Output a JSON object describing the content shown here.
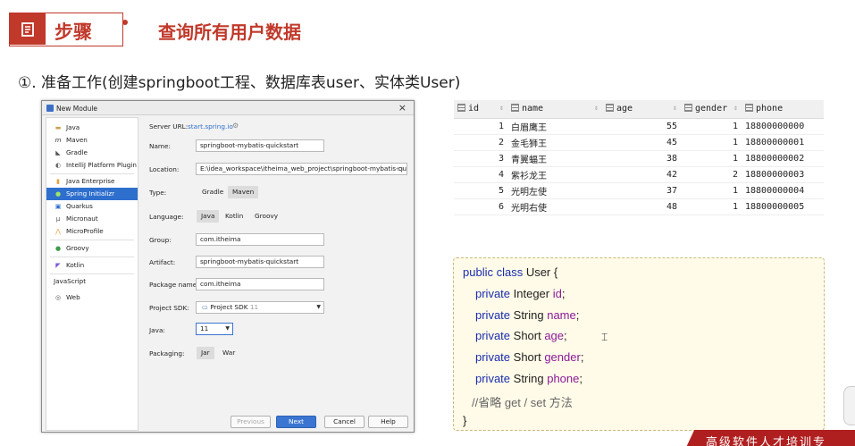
{
  "header": {
    "step_label": "步骤",
    "title": "查询所有用户数据"
  },
  "subheading": "①. 准备工作(创建springboot工程、数据库表user、实体类User)",
  "dialog": {
    "title": "New Module",
    "close": "×",
    "sidebar": [
      {
        "label": "Java",
        "icon": "folder-icon"
      },
      {
        "label": "Maven",
        "icon": "maven-icon"
      },
      {
        "label": "Gradle",
        "icon": "gradle-icon"
      },
      {
        "label": "IntelliJ Platform Plugin",
        "icon": "plugin-icon"
      },
      {
        "label": "Java Enterprise",
        "icon": "enterprise-icon"
      },
      {
        "label": "Spring Initializr",
        "icon": "spring-icon"
      },
      {
        "label": "Quarkus",
        "icon": "quarkus-icon"
      },
      {
        "label": "Micronaut",
        "icon": "micronaut-icon"
      },
      {
        "label": "MicroProfile",
        "icon": "microprofile-icon"
      },
      {
        "label": "Groovy",
        "icon": "groovy-icon"
      },
      {
        "label": "Kotlin",
        "icon": "kotlin-icon"
      },
      {
        "label": "JavaScript",
        "icon": ""
      },
      {
        "label": "Web",
        "icon": "web-icon"
      }
    ],
    "server_url_label": "Server URL:",
    "server_url": "start.spring.io",
    "name_label": "Name:",
    "name_value": "springboot-mybatis-quickstart",
    "location_label": "Location:",
    "location_value": "E:\\idea_workspace\\itheima_web_project\\springboot-mybatis-quic",
    "type_label": "Type:",
    "type_options": [
      "Gradle",
      "Maven"
    ],
    "language_label": "Language:",
    "language_options": [
      "Java",
      "Kotlin",
      "Groovy"
    ],
    "group_label": "Group:",
    "group_value": "com.itheima",
    "artifact_label": "Artifact:",
    "artifact_value": "springboot-mybatis-quickstart",
    "package_label": "Package name:",
    "package_value": "com.itheima",
    "sdk_label": "Project SDK:",
    "sdk_value": "Project SDK",
    "sdk_version": "11",
    "java_label": "Java:",
    "java_value": "11",
    "packaging_label": "Packaging:",
    "packaging_options": [
      "Jar",
      "War"
    ],
    "buttons": {
      "previous": "Previous",
      "next": "Next",
      "cancel": "Cancel",
      "help": "Help"
    }
  },
  "table": {
    "columns": [
      "id",
      "name",
      "age",
      "gender",
      "phone"
    ],
    "rows": [
      [
        "1",
        "白眉鹰王",
        "55",
        "1",
        "18800000000"
      ],
      [
        "2",
        "金毛狮王",
        "45",
        "1",
        "18800000001"
      ],
      [
        "3",
        "青翼蝠王",
        "38",
        "1",
        "18800000002"
      ],
      [
        "4",
        "紫衫龙王",
        "42",
        "2",
        "18800000003"
      ],
      [
        "5",
        "光明左使",
        "37",
        "1",
        "18800000004"
      ],
      [
        "6",
        "光明右使",
        "48",
        "1",
        "18800000005"
      ]
    ]
  },
  "code": {
    "l1_kw": "public class",
    "l1_rest": " User {",
    "fields": [
      {
        "kw": "private",
        "type": " Integer ",
        "name": "id",
        "end": ";"
      },
      {
        "kw": "private",
        "type": " String ",
        "name": "name",
        "end": ";"
      },
      {
        "kw": "private",
        "type": " Short ",
        "name": "age",
        "end": ";"
      },
      {
        "kw": "private",
        "type": " Short ",
        "name": "gender",
        "end": ";"
      },
      {
        "kw": "private",
        "type": " String ",
        "name": "phone",
        "end": ";"
      }
    ],
    "comment": "//省略 get / set 方法",
    "close": "}"
  },
  "banner": "高级软件人才培训专"
}
